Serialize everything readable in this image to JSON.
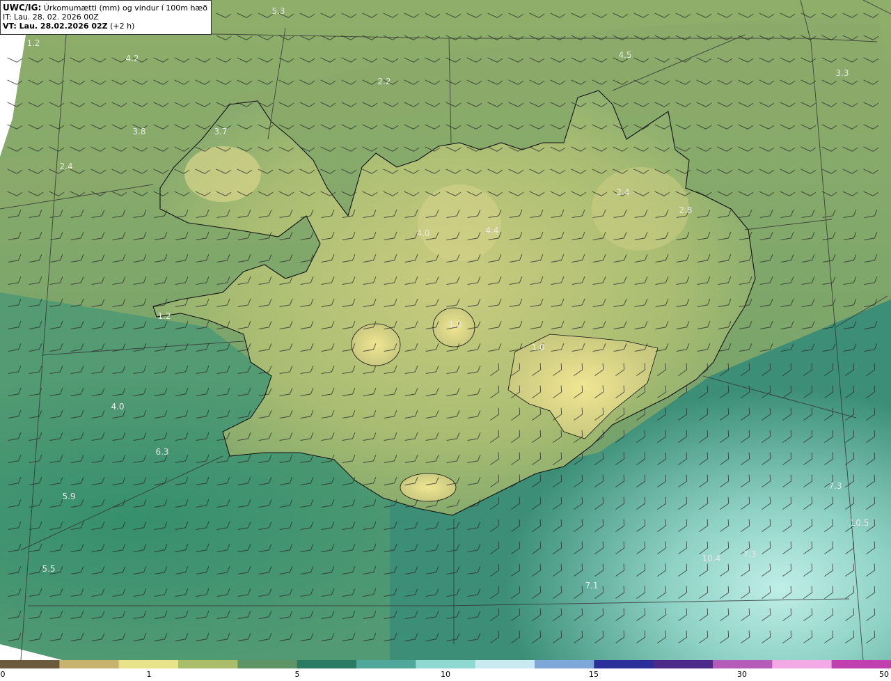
{
  "header": {
    "model": "UWC/IG:",
    "title": "Úrkomumætti (mm) og vindur í 100m hæð",
    "init_time": "IT: Lau. 28. 02. 2026 00Z",
    "valid_prefix": "VT: Lau. 28.02.2026 02Z",
    "valid_suffix": "(+2 h)"
  },
  "map_labels": [
    "5.3",
    "4.2",
    "4.5",
    "3.3",
    "3.8",
    "3.7",
    "2.4",
    "4.0",
    "4.4",
    "2.4",
    "2.8",
    "1.0",
    "1.0",
    "4.0",
    "6.3",
    "5.9",
    "5.5",
    "7.3",
    "10.5",
    "10.4",
    "7.3",
    "1.2",
    "2.2",
    "1.2",
    "7.1"
  ],
  "colorbar": {
    "ticks": [
      "0",
      "1",
      "5",
      "10",
      "15",
      "30",
      "50"
    ],
    "colors": [
      "#6b5a3e",
      "#c7b36f",
      "#e8e28a",
      "#a9bd6b",
      "#5f9466",
      "#2b7a63",
      "#4fa89a",
      "#8fd9d2",
      "#c8eaf0",
      "#7fa8d8",
      "#2a2f9a",
      "#4b2a8a",
      "#b45cb8",
      "#f2a9e6",
      "#c040b0"
    ]
  },
  "colors": {
    "land_high": "#e3df8f",
    "land_mid": "#9fb570",
    "sea_west": "#3a8a6a",
    "sea_southeast": "#9fd9cf",
    "coastline": "#111111"
  }
}
